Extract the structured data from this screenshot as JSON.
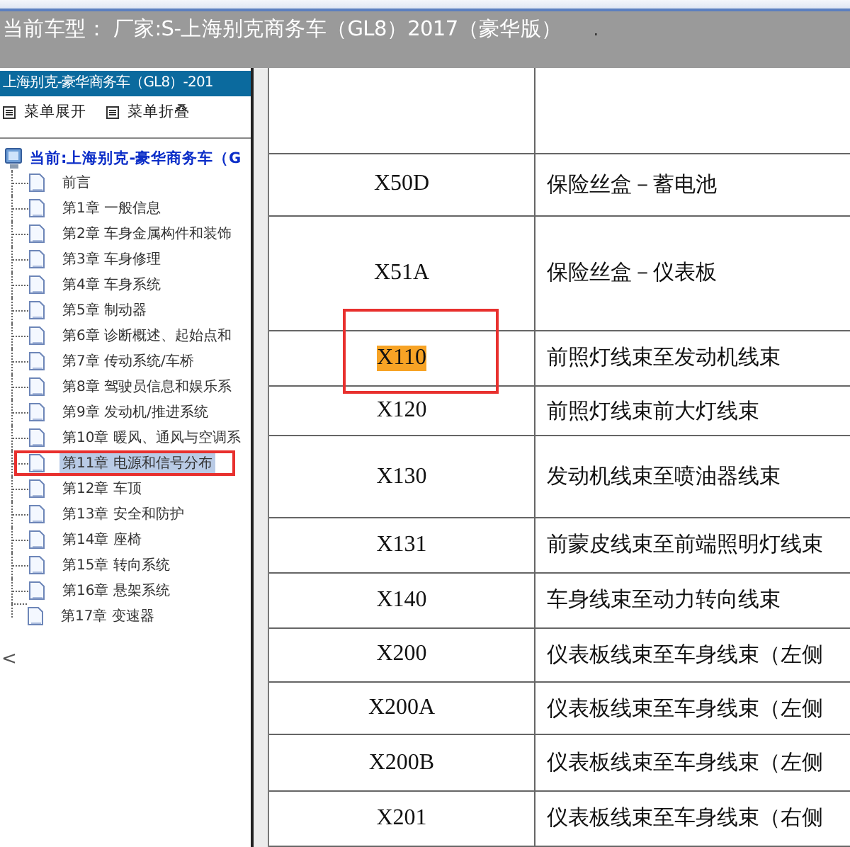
{
  "header": {
    "title": "当前车型： 厂家:S-上海别克商务车（GL8）2017（豪华版）",
    "mark": "."
  },
  "sidebar": {
    "title": "上海别克-豪华商务车（GL8）-201",
    "actions": [
      {
        "label": "菜单展开"
      },
      {
        "label": "菜单折叠"
      }
    ],
    "tree": {
      "label": "当前:上海别克-豪华商务车（G",
      "children": [
        {
          "label": "前言",
          "selected": false,
          "highlighted": false
        },
        {
          "label": "第1章 一般信息",
          "selected": false,
          "highlighted": false
        },
        {
          "label": "第2章 车身金属构件和装饰",
          "selected": false,
          "highlighted": false
        },
        {
          "label": "第3章 车身修理",
          "selected": false,
          "highlighted": false
        },
        {
          "label": "第4章 车身系统",
          "selected": false,
          "highlighted": false
        },
        {
          "label": "第5章 制动器",
          "selected": false,
          "highlighted": false
        },
        {
          "label": "第6章 诊断概述、起始点和",
          "selected": false,
          "highlighted": false
        },
        {
          "label": "第7章 传动系统/车桥",
          "selected": false,
          "highlighted": false
        },
        {
          "label": "第8章 驾驶员信息和娱乐系",
          "selected": false,
          "highlighted": false
        },
        {
          "label": "第9章 发动机/推进系统",
          "selected": false,
          "highlighted": false
        },
        {
          "label": "第10章 暖风、通风与空调系",
          "selected": false,
          "highlighted": false
        },
        {
          "label": "第11章 电源和信号分布",
          "selected": true,
          "highlighted": true
        },
        {
          "label": "第12章 车顶",
          "selected": false,
          "highlighted": false
        },
        {
          "label": "第13章 安全和防护",
          "selected": false,
          "highlighted": false
        },
        {
          "label": "第14章 座椅",
          "selected": false,
          "highlighted": false
        },
        {
          "label": "第15章 转向系统",
          "selected": false,
          "highlighted": false
        },
        {
          "label": "第16章 悬架系统",
          "selected": false,
          "highlighted": false
        },
        {
          "label": "第17章 变速器",
          "selected": false,
          "highlighted": false
        }
      ]
    },
    "scroll_hint": "<"
  },
  "table": {
    "rows": [
      {
        "code": "",
        "description": "",
        "highlighted": false
      },
      {
        "code": "X50D",
        "description": "保险丝盒－蓄电池",
        "highlighted": false
      },
      {
        "code": "X51A",
        "description": "保险丝盒－仪表板",
        "highlighted": false
      },
      {
        "code": "X110",
        "description": "前照灯线束至发动机线束",
        "highlighted": true
      },
      {
        "code": "X120",
        "description": "前照灯线束前大灯线束",
        "highlighted": false
      },
      {
        "code": "X130",
        "description": "发动机线束至喷油器线束",
        "highlighted": false
      },
      {
        "code": "X131",
        "description": "前蒙皮线束至前端照明灯线束",
        "highlighted": false
      },
      {
        "code": "X140",
        "description": "车身线束至动力转向线束",
        "highlighted": false
      },
      {
        "code": "X200",
        "description": "仪表板线束至车身线束（左侧",
        "highlighted": false
      },
      {
        "code": "X200A",
        "description": "仪表板线束至车身线束（左侧",
        "highlighted": false
      },
      {
        "code": "X200B",
        "description": "仪表板线束至车身线束（左侧",
        "highlighted": false
      },
      {
        "code": "X201",
        "description": "仪表板线束至车身线束（右侧",
        "highlighted": false
      }
    ]
  }
}
